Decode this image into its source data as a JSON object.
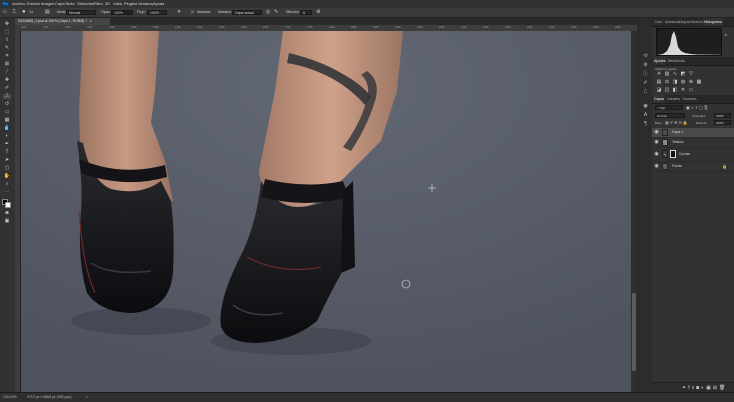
{
  "menubar": {
    "logo": "Ps",
    "items": [
      "Archivo",
      "Edición",
      "Imagen",
      "Capa",
      "Texto",
      "Selección",
      "Filtro",
      "3D",
      "Vista",
      "Plugins",
      "Ventana",
      "Ayuda"
    ]
  },
  "options": {
    "size": "14",
    "mode_label": "Modo:",
    "mode_value": "Normal",
    "opacity_label": "Opac.:",
    "opacity_value": "100%",
    "flow_label": "Flujo:",
    "flow_value": "100%",
    "aligned_label": "Alineado",
    "sample_label": "Muestra:",
    "sample_value": "Capa actual",
    "diffusion_label": "Difusión:",
    "diffusion_value": "5"
  },
  "document_tab": {
    "title": "DSC6808_3.psd al 100% (Capa 1, RGB/8) *",
    "close": "×"
  },
  "ruler_labels": [
    "1100",
    "1150",
    "1200",
    "1250",
    "1300",
    "1350",
    "1400",
    "1450",
    "1500",
    "1550",
    "1600",
    "1650",
    "1700",
    "1750",
    "1800",
    "1850",
    "1900",
    "1950",
    "2000",
    "2050",
    "2100",
    "2150",
    "2200",
    "2250",
    "2300",
    "2350",
    "2400",
    "2450"
  ],
  "status": {
    "zoom": "100,02%",
    "doc_size": "3712 px x 5568 px (300 ppp)",
    "arrow": ">"
  },
  "panels": {
    "top_tabs": [
      "Color",
      "Muestras",
      "Degrad.",
      "Motivos",
      "Histograma"
    ],
    "active_top_tab": "Histograma",
    "adj_tabs": [
      "Ajustes",
      "Bibliotecas"
    ],
    "adj_hint": "Añadir un ajuste",
    "layer_tabs": [
      "Capas",
      "Canales",
      "Trazados"
    ],
    "kind_label": "Tipo",
    "blend_mode": "Normal",
    "opacity_label": "Opacidad:",
    "opacity_value": "100%",
    "lock_label": "Bloq.:",
    "fill_label": "Relleno:",
    "fill_value": "100%",
    "layers": [
      {
        "name": "Capa 1",
        "selected": true
      },
      {
        "name": "Textura",
        "selected": false
      },
      {
        "name": "Curvas",
        "selected": false
      },
      {
        "name": "Fondo",
        "selected": false
      }
    ]
  },
  "colors": {
    "canvas_bg": "#555a66",
    "panel_bg": "#323232",
    "accent": "#31a8ff"
  },
  "icons": {
    "tools": [
      "move-icon",
      "marquee-icon",
      "lasso-icon",
      "quick-select-icon",
      "crop-icon",
      "frame-icon",
      "eyedropper-icon",
      "healing-icon",
      "brush-icon",
      "clone-stamp-icon",
      "history-brush-icon",
      "eraser-icon",
      "gradient-icon",
      "blur-icon",
      "dodge-icon",
      "pen-icon",
      "type-icon",
      "path-select-icon",
      "rectangle-icon",
      "hand-icon",
      "zoom-icon"
    ]
  }
}
